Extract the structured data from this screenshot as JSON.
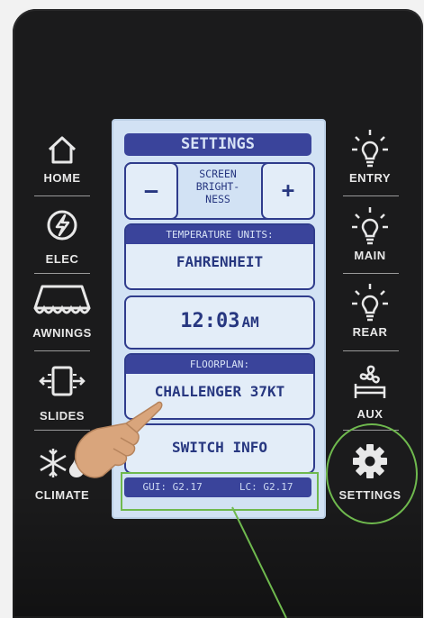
{
  "left_menu": [
    {
      "label": "HOME",
      "icon": "home-icon"
    },
    {
      "label": "ELEC",
      "icon": "electric-icon"
    },
    {
      "label": "AWNINGS",
      "icon": "awning-icon"
    },
    {
      "label": "SLIDES",
      "icon": "slides-icon"
    },
    {
      "label": "CLIMATE",
      "icon": "snowflake-flame-icon"
    }
  ],
  "right_menu": [
    {
      "label": "ENTRY",
      "icon": "light-bulb-icon"
    },
    {
      "label": "MAIN",
      "icon": "light-bulb-icon"
    },
    {
      "label": "REAR",
      "icon": "light-bulb-icon"
    },
    {
      "label": "AUX",
      "icon": "fan-bed-icon"
    },
    {
      "label": "SETTINGS",
      "icon": "gear-icon"
    }
  ],
  "screen": {
    "title": "SETTINGS",
    "brightness": {
      "minus": "–",
      "plus": "+",
      "label_lines": [
        "SCREEN",
        "BRIGHT-",
        "NESS"
      ]
    },
    "temperature": {
      "header": "TEMPERATURE UNITS:",
      "value": "FAHRENHEIT"
    },
    "time": {
      "value": "12:03",
      "suffix": "AM"
    },
    "floorplan": {
      "header": "FLOORPLAN:",
      "value": "CHALLENGER 37KT"
    },
    "switch_info": "SWITCH INFO",
    "versions": {
      "gui": "GUI: G2.17",
      "lc": "LC: G2.17"
    }
  },
  "colors": {
    "annotation": "#6fb94e",
    "screen_bg": "#d2e2f4",
    "accent": "#2f3c8c"
  }
}
